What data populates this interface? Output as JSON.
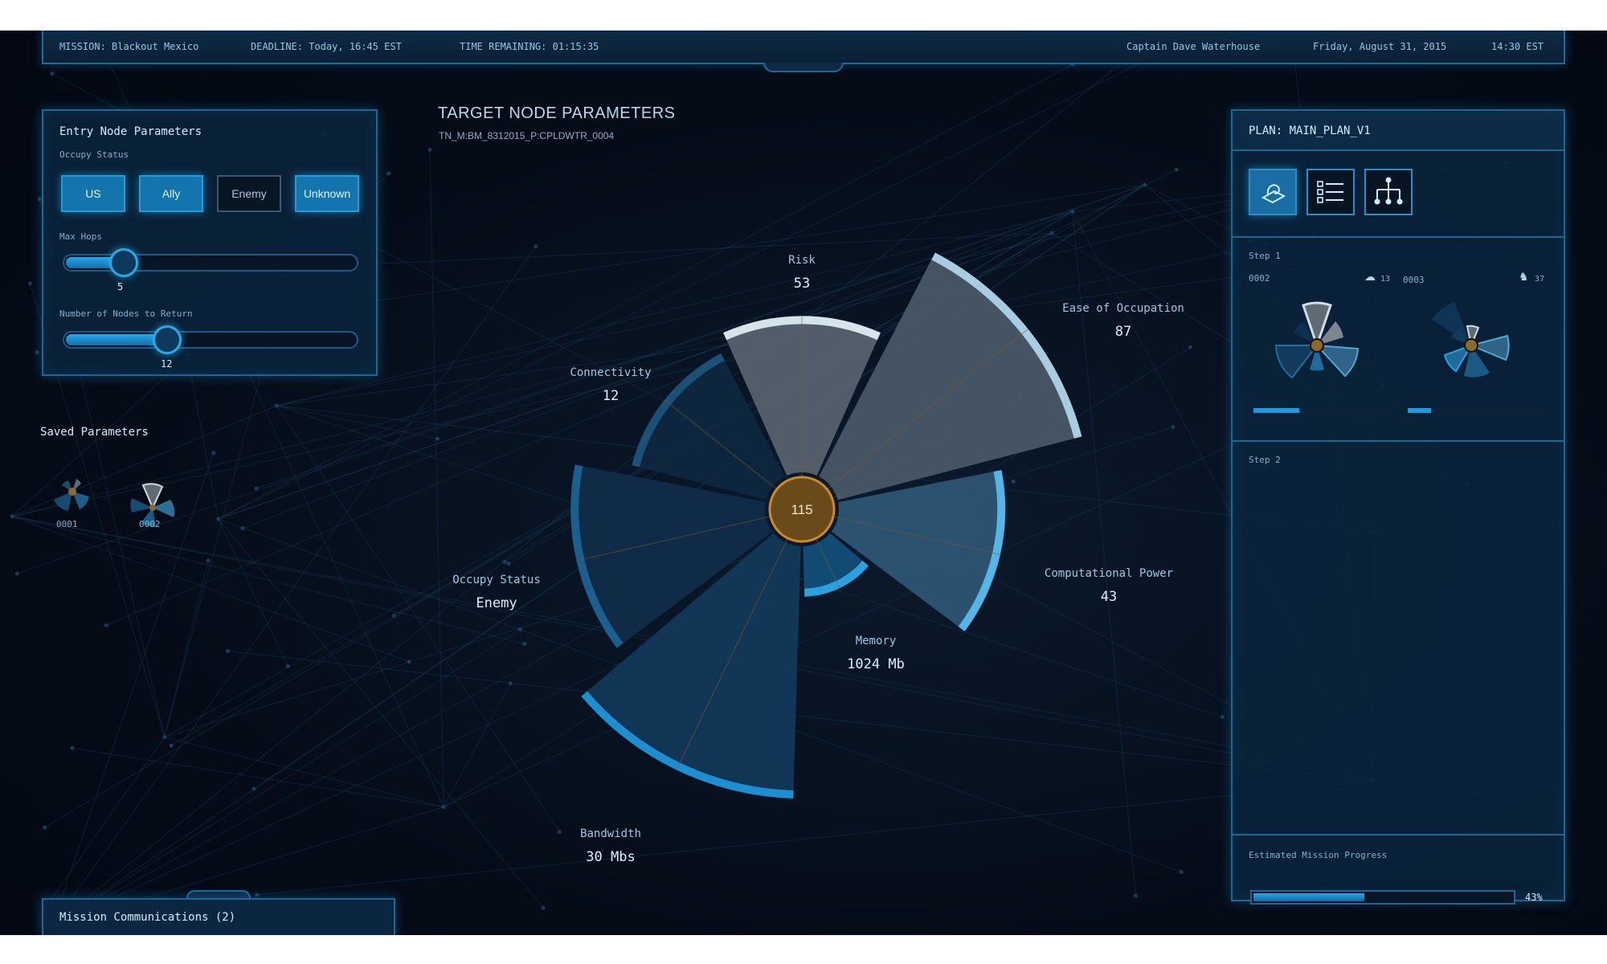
{
  "topbar": {
    "mission": "MISSION: Blackout Mexico",
    "deadline": "DEADLINE: Today, 16:45 EST",
    "remaining": "TIME REMAINING: 01:15:35",
    "user": "Captain Dave Waterhouse",
    "date": "Friday, August 31, 2015",
    "time": "14:30 EST"
  },
  "entry_panel": {
    "title": "Entry Node Parameters",
    "occupy_label": "Occupy Status",
    "occupy_options": [
      "US",
      "Ally",
      "Enemy",
      "Unknown"
    ],
    "occupy_selected": [
      "US",
      "Ally",
      "Unknown"
    ],
    "max_hops_label": "Max Hops",
    "max_hops_value": "5",
    "max_hops_fraction": 0.2,
    "nodes_label": "Number of Nodes to Return",
    "nodes_value": "12",
    "nodes_fraction": 0.35
  },
  "saved": {
    "title": "Saved Parameters",
    "items": [
      "0001",
      "0002"
    ]
  },
  "target": {
    "title": "TARGET NODE PARAMETERS",
    "subtitle": "TN_M:BM_8312015_P:CPLDWTR_0004",
    "center_value": "115"
  },
  "chart_data": {
    "type": "radial-bar",
    "center": 115,
    "axes": [
      {
        "name": "Risk",
        "value": "53",
        "level": 0.62,
        "color": "#5a6470",
        "cap": "#d7e3ea"
      },
      {
        "name": "Ease of Occupation",
        "value": "87",
        "level": 1.0,
        "color": "#4a5a68",
        "cap": "#a8cde0"
      },
      {
        "name": "Computational Power",
        "value": "43",
        "level": 0.66,
        "color": "#2f5774",
        "cap": "#54b6e6"
      },
      {
        "name": "Memory",
        "value": "1024 Mb",
        "level": 0.2,
        "color": "#124f7a",
        "cap": "#2aa2e0"
      },
      {
        "name": "Bandwidth",
        "value": "30 Mbs",
        "level": 1.0,
        "color": "#123a5a",
        "cap": "#1c8fd0"
      },
      {
        "name": "Occupy Status",
        "value": "Enemy",
        "level": 0.77,
        "color": "#102e4a",
        "cap": "#1a5f8e"
      },
      {
        "name": "Connectivity",
        "value": "12",
        "level": 0.55,
        "color": "#0e2840",
        "cap": "#1a5175"
      }
    ]
  },
  "plan": {
    "title": "PLAN: MAIN_PLAN_V1",
    "view_buttons": [
      "map-icon",
      "list-icon",
      "tree-icon"
    ],
    "step1_label": "Step 1",
    "step1_nodes": [
      {
        "id": "0002",
        "count": "13",
        "icon": "cloud-icon",
        "progress": 0.33
      },
      {
        "id": "0003",
        "count": "37",
        "icon": "horse-icon",
        "progress": 0.17
      }
    ],
    "step2_label": "Step 2",
    "progress_label": "Estimated Mission Progress",
    "progress_value": "43%",
    "progress_fraction": 0.43
  },
  "comms": {
    "label": "Mission Communications (2)"
  }
}
